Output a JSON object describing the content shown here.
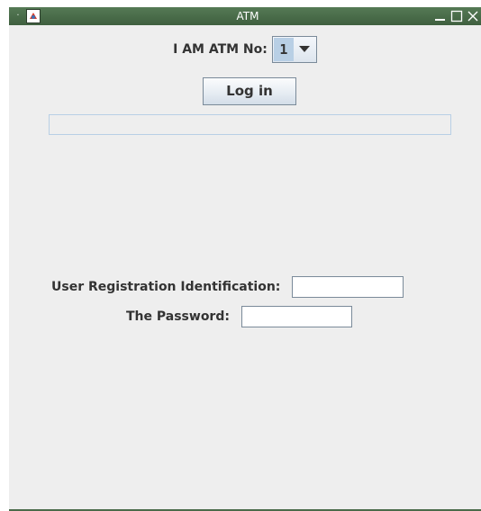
{
  "window": {
    "title": "ATM",
    "menu_glyph": "·",
    "icon": "app-icon",
    "controls": [
      "minimize-icon",
      "maximize-icon",
      "close-icon"
    ]
  },
  "atm_selector": {
    "label": "I AM ATM No:",
    "selected": "1"
  },
  "login": {
    "label": "Log in"
  },
  "status": {
    "text": ""
  },
  "form": {
    "user_label": "User Registration Identification:",
    "user_value": "",
    "password_label": "The Password:",
    "password_value": ""
  },
  "colors": {
    "titlebar": "#4a6b4a",
    "window_bg": "#eeeeee",
    "selection": "#b8cfe5",
    "border": "#7a8a99"
  }
}
